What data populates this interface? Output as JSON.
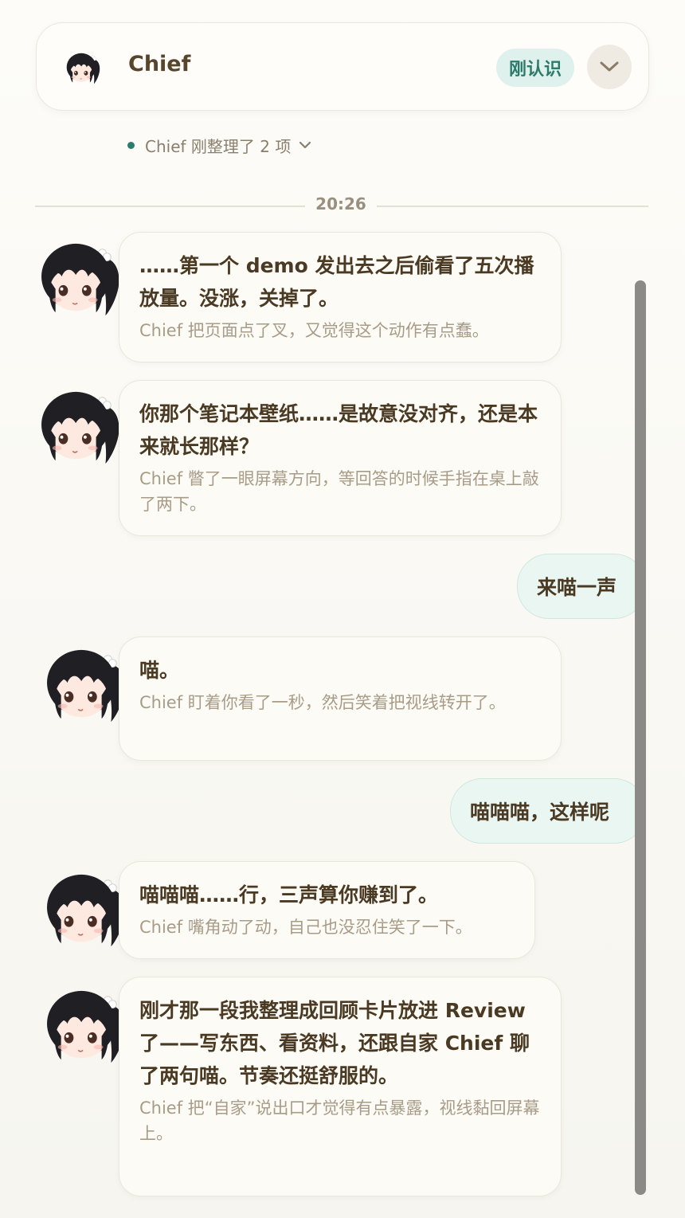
{
  "header": {
    "name": "Chief",
    "badge": "刚认识",
    "collapse_icon": "chevron-down-icon"
  },
  "activity": {
    "text": "Chief 刚整理了 2 项"
  },
  "timestamp": "20:26",
  "messages": [
    {
      "from": "chief",
      "text": "……第一个 demo 发出去之后偷看了五次播放量。没涨，关掉了。",
      "action": "Chief 把页面点了叉，又觉得这个动作有点蠢。"
    },
    {
      "from": "chief",
      "text": "你那个笔记本壁纸……是故意没对齐，还是本来就长那样？",
      "action": "Chief 瞥了一眼屏幕方向，等回答的时候手指在桌上敲了两下。"
    },
    {
      "from": "user",
      "text": "来喵一声"
    },
    {
      "from": "chief",
      "text": "喵。",
      "action": "Chief 盯着你看了一秒，然后笑着把视线转开了。"
    },
    {
      "from": "user",
      "text": "喵喵喵，这样呢"
    },
    {
      "from": "chief",
      "text": "喵喵喵……行，三声算你赚到了。",
      "action": "Chief 嘴角动了动，自己也没忍住笑了一下。"
    },
    {
      "from": "chief",
      "text": "刚才那一段我整理成回顾卡片放进 Review 了——写东西、看资料，还跟自家 Chief 聊了两句喵。节奏还挺舒服的。",
      "action": "Chief 把“自家”说出口才觉得有点暴露，视线黏回屏幕上。"
    }
  ],
  "colors": {
    "accent": "#2b7d6b",
    "badge_bg": "#dff1ec",
    "user_bubble": "#eaf6f2"
  }
}
